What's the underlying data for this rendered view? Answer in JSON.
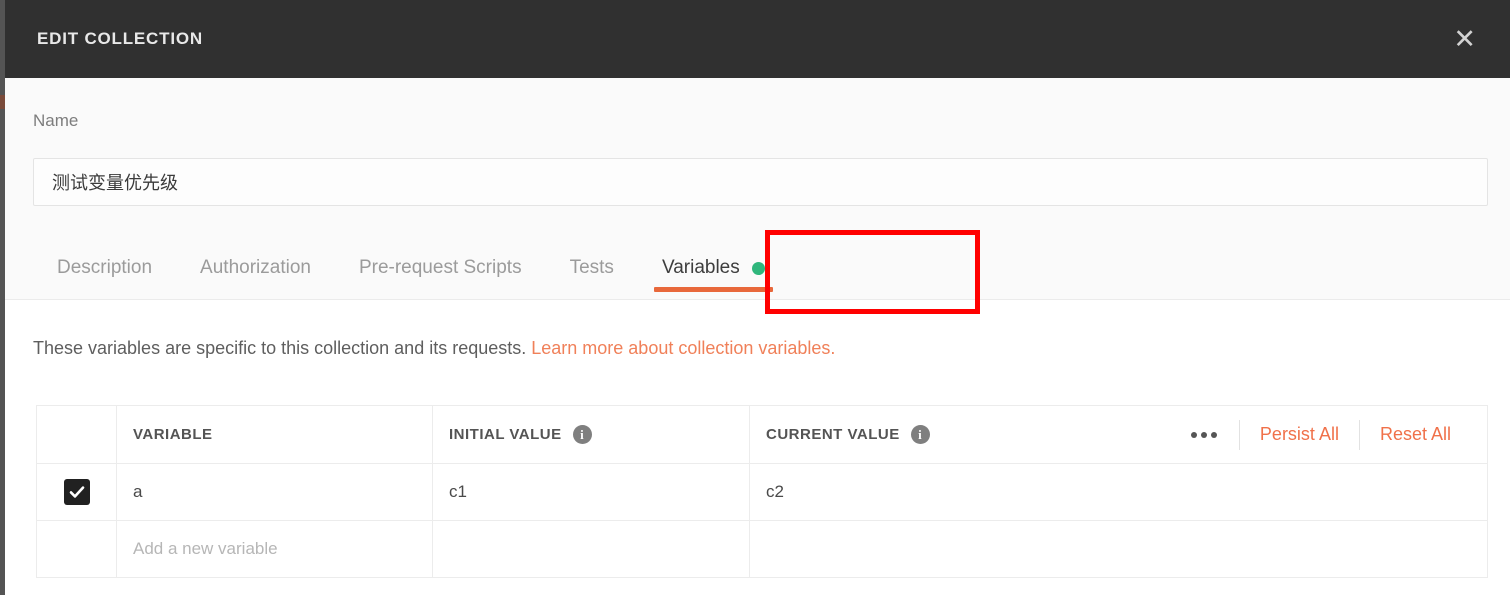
{
  "header": {
    "title": "EDIT COLLECTION",
    "close_icon": "close-icon",
    "close_glyph": "✕"
  },
  "name_section": {
    "label": "Name",
    "value": "测试变量优先级",
    "placeholder": "Name"
  },
  "tabs": [
    {
      "label": "Description",
      "active": false
    },
    {
      "label": "Authorization",
      "active": false
    },
    {
      "label": "Pre-request Scripts",
      "active": false
    },
    {
      "label": "Tests",
      "active": false
    },
    {
      "label": "Variables",
      "active": true,
      "badge_dot": true
    }
  ],
  "description": {
    "text": "These variables are specific to this collection and its requests. ",
    "link_text": "Learn more about collection variables."
  },
  "table": {
    "columns": [
      {
        "key": "check",
        "label": ""
      },
      {
        "key": "variable",
        "label": "VARIABLE"
      },
      {
        "key": "initial",
        "label": "INITIAL VALUE",
        "info_icon": "info-icon"
      },
      {
        "key": "current",
        "label": "CURRENT VALUE",
        "info_icon": "info-icon"
      }
    ],
    "header_actions": {
      "more_icon": "more-options-icon",
      "persist_all": "Persist All",
      "reset_all": "Reset All"
    },
    "rows": [
      {
        "checked": true,
        "variable": "a",
        "initial": "c1",
        "current": "c2"
      }
    ],
    "new_row_placeholder": "Add a new variable"
  },
  "colors": {
    "header_bg": "#303030",
    "accent_orange": "#e8683b",
    "link_orange": "#f08059",
    "badge_green": "#2fb67c",
    "annotation_red": "#ff0000"
  }
}
